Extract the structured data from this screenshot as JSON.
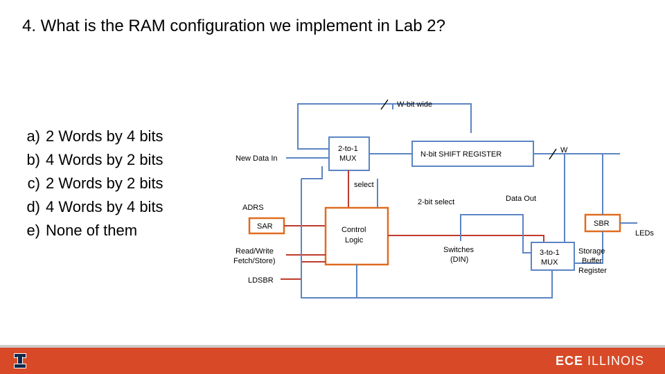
{
  "question": {
    "text": "4. What is the RAM configuration we implement in Lab 2?"
  },
  "answers": {
    "a": {
      "letter": "a)",
      "text": "2 Words by 4 bits"
    },
    "b": {
      "letter": "b)",
      "text": "4 Words by 2 bits"
    },
    "c": {
      "letter": "c)",
      "text": "2 Words by 2 bits"
    },
    "d": {
      "letter": "d)",
      "text": "4 Words by 4 bits"
    },
    "e": {
      "letter": "e)",
      "text": "None of them"
    }
  },
  "diagram": {
    "labels": {
      "wbit": "W-bit wide",
      "newdata": "New Data In",
      "mux21": "2-to-1\nMUX",
      "shiftreg": "N-bit SHIFT REGISTER",
      "select": "select",
      "adrs": "ADRS",
      "sar": "SAR",
      "control": "Control\nLogic",
      "bitsel2": "2-bit select",
      "dataout": "Data Out",
      "w": "W",
      "sbr": "SBR",
      "leds": "LEDs",
      "mux31": "3-to-1\nMUX",
      "switches": "Switches\n(DIN)",
      "storage": "Storage\nBuffer\nRegister",
      "rw": "Read/Write\nFetch/Store)",
      "ldsbr": "LDSBR"
    }
  },
  "footer": {
    "brand_prefix": "ECE ",
    "brand_main": "ILLINOIS"
  }
}
